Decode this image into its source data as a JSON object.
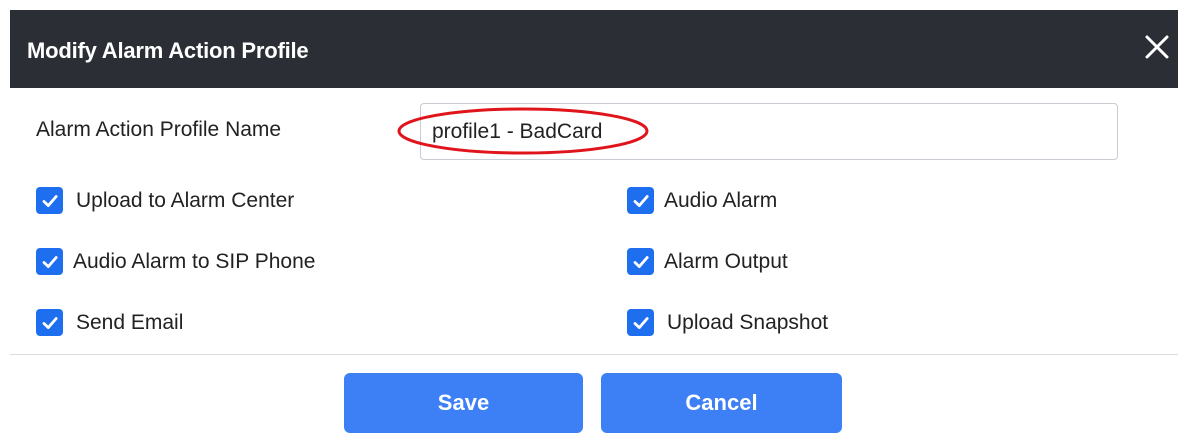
{
  "dialog": {
    "title": "Modify Alarm Action Profile",
    "close_icon": "close-icon"
  },
  "form": {
    "name_label": "Alarm Action Profile Name",
    "name_value": "profile1 - BadCard"
  },
  "options": [
    {
      "label": "Upload to Alarm Center",
      "checked": true
    },
    {
      "label": "Audio Alarm",
      "checked": true
    },
    {
      "label": "Audio Alarm to SIP Phone",
      "checked": true
    },
    {
      "label": "Alarm Output",
      "checked": true
    },
    {
      "label": "Send Email",
      "checked": true
    },
    {
      "label": "Upload Snapshot",
      "checked": true
    }
  ],
  "buttons": {
    "save": "Save",
    "cancel": "Cancel"
  },
  "colors": {
    "titlebar": "#2c2e36",
    "checkbox": "#1e6ff0",
    "button": "#3d7ff5",
    "annotation": "#e0151c"
  }
}
